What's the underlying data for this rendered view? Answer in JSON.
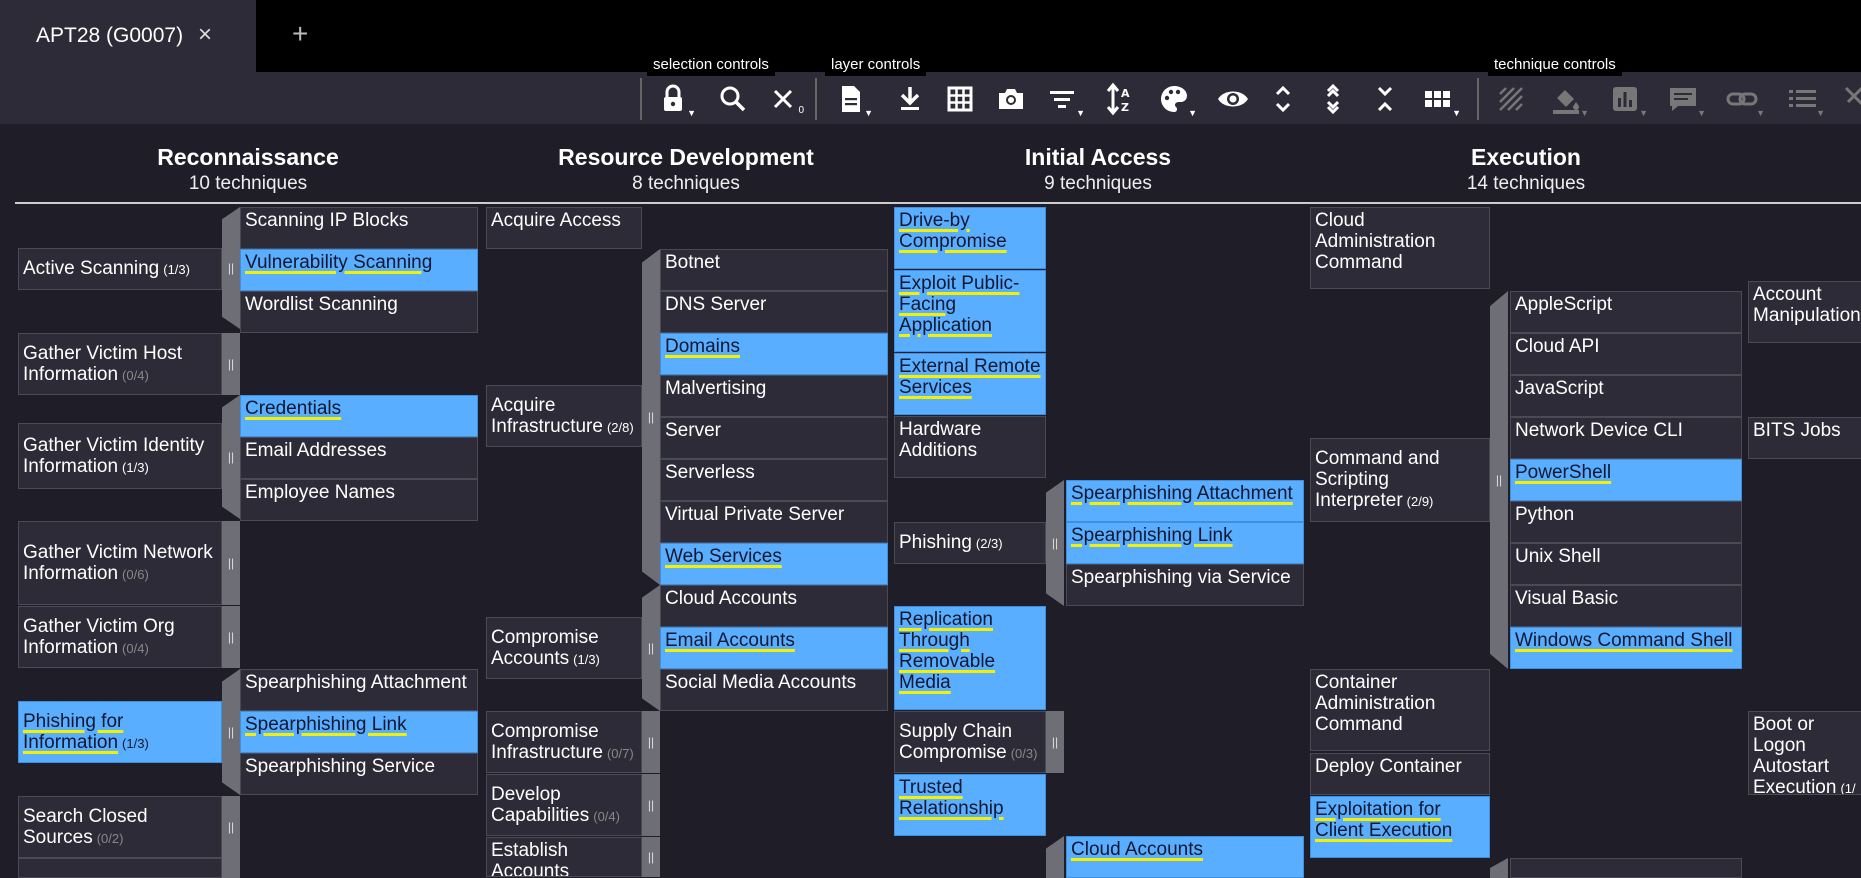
{
  "tab": {
    "title": "APT28 (G0007)",
    "close_icon": "×",
    "new_tab": "+"
  },
  "toolbar": {
    "selection_label": "selection controls",
    "layer_label": "layer controls",
    "technique_label": "technique controls",
    "deselect_count": "0"
  },
  "tactics": [
    {
      "name": "Reconnaissance",
      "count": "10 techniques"
    },
    {
      "name": "Resource Development",
      "count": "8 techniques"
    },
    {
      "name": "Initial Access",
      "count": "9 techniques"
    },
    {
      "name": "Execution",
      "count": "14 techniques"
    }
  ],
  "recon": {
    "active_scanning": {
      "name": "Active Scanning",
      "sub": "(1/3)"
    },
    "active_subs": [
      "Scanning IP Blocks",
      "Vulnerability Scanning",
      "Wordlist Scanning"
    ],
    "gather_host": {
      "name": "Gather Victim Host Information",
      "sub": "(0/4)"
    },
    "gather_identity": {
      "name": "Gather Victim Identity Information",
      "sub": "(1/3)"
    },
    "identity_subs": [
      "Credentials",
      "Email Addresses",
      "Employee Names"
    ],
    "gather_network": {
      "name": "Gather Victim Network Information",
      "sub": "(0/6)"
    },
    "gather_org": {
      "name": "Gather Victim Org Information",
      "sub": "(0/4)"
    },
    "phishing_info": {
      "name": "Phishing for Information",
      "sub": "(1/3)"
    },
    "phishing_subs": [
      "Spearphishing Attachment",
      "Spearphishing Link",
      "Spearphishing Service"
    ],
    "search_closed": {
      "name": "Search Closed Sources",
      "sub": "(0/2)"
    }
  },
  "resdev": {
    "acquire_access": "Acquire Access",
    "acquire_infra": {
      "name": "Acquire Infrastructure",
      "sub": "(2/8)"
    },
    "infra_subs": [
      "Botnet",
      "DNS Server",
      "Domains",
      "Malvertising",
      "Server",
      "Serverless",
      "Virtual Private Server",
      "Web Services"
    ],
    "compromise_accounts": {
      "name": "Compromise Accounts",
      "sub": "(1/3)"
    },
    "accounts_subs": [
      "Cloud Accounts",
      "Email Accounts",
      "Social Media Accounts"
    ],
    "compromise_infra": {
      "name": "Compromise Infrastructure",
      "sub": "(0/7)"
    },
    "develop_cap": {
      "name": "Develop Capabilities",
      "sub": "(0/4)"
    },
    "establish": {
      "name": "Establish Accounts",
      "sub": ""
    }
  },
  "initial": {
    "drive_by": "Drive-by Compromise",
    "exploit_public": "Exploit Public-Facing Application",
    "external_remote": "External Remote Services",
    "hardware": "Hardware Additions",
    "phishing": {
      "name": "Phishing",
      "sub": "(2/3)"
    },
    "phishing_subs": [
      "Spearphishing Attachment",
      "Spearphishing Link",
      "Spearphishing via Service"
    ],
    "replication": "Replication Through Removable Media",
    "supply_chain": {
      "name": "Supply Chain Compromise",
      "sub": "(0/3)"
    },
    "trusted": "Trusted Relationship",
    "valid_sub_cloud": "Cloud Accounts"
  },
  "execution": {
    "cloud_admin": "Cloud Administration Command",
    "cmd_script": {
      "name": "Command and Scripting Interpreter",
      "sub": "(2/9)"
    },
    "cmd_subs": [
      "AppleScript",
      "Cloud API",
      "JavaScript",
      "Network Device CLI",
      "PowerShell",
      "Python",
      "Unix Shell",
      "Visual Basic",
      "Windows Command Shell"
    ],
    "container_admin": "Container Administration Command",
    "deploy_container": "Deploy Container",
    "exploitation_client": "Exploitation for Client Execution"
  },
  "next_col": {
    "account_manip": "Account Manipulation",
    "bits_jobs": "BITS Jobs",
    "boot_logon": {
      "name": "Boot or Logon Autostart Execution",
      "sub": "(1/"
    }
  }
}
